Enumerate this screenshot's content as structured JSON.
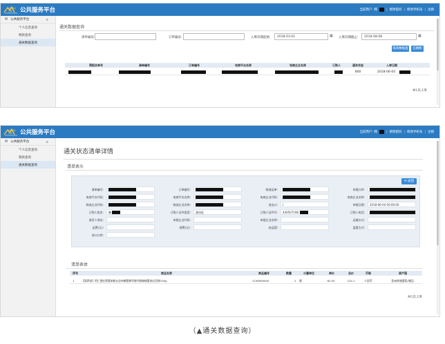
{
  "app": {
    "title": "公共服务平台",
    "logo_text": "中国电子口岸",
    "current_user_label": "当前用户: 韩",
    "links": [
      "修改密码",
      "修改手机号",
      "注销"
    ],
    "accent": "#2b7bc2"
  },
  "sidebar": {
    "header": "公共服务平台",
    "items": [
      "个人信息查询",
      "税款查询",
      "通关数据查询"
    ],
    "active_index": 2
  },
  "query": {
    "heading": "通关数据查询",
    "fields": [
      {
        "label": "清单编号:",
        "value": ""
      },
      {
        "label": "订单编号:",
        "value": ""
      },
      {
        "label": "入库日期起始:",
        "value": "2018-03-01"
      },
      {
        "label": "入库日期截止:",
        "value": "2018-08-08"
      }
    ],
    "buttons": [
      "电商数据查询",
      "已缴税"
    ],
    "table": {
      "columns": [
        "预报关单号",
        "清单编号",
        "订单编号",
        "电商平台名称",
        "电商企业名称",
        "订购人",
        "通关状态",
        "入库日期"
      ],
      "rows": [
        {
          "status": "800",
          "date": "2018-06-04"
        }
      ]
    },
    "pager": "共1页,1项"
  },
  "detail": {
    "heading": "通关状态清单详情",
    "header_section": "清单表头",
    "back_label": "返回",
    "rows": [
      [
        {
          "label": "清单编号:",
          "value": "",
          "redacted": true
        },
        {
          "label": "订单编号:",
          "value": "",
          "redacted": true
        },
        {
          "label": "物流运单:",
          "value": "",
          "redacted": true
        },
        {
          "label": "申报口岸:",
          "value": "",
          "redacted": true
        }
      ],
      [
        {
          "label": "电商平台代码:",
          "value": "",
          "redacted": true
        },
        {
          "label": "电商平台名称:",
          "value": "",
          "redacted": true
        },
        {
          "label": "电商企业代码:",
          "value": "",
          "redacted": true
        },
        {
          "label": "电商企业名称:",
          "value": "",
          "redacted": true
        }
      ],
      [
        {
          "label": "物流企业代码:",
          "value": "",
          "redacted": true
        },
        {
          "label": "物流企业名称:",
          "value": "",
          "redacted": true
        },
        {
          "label": "进出口:",
          "value": "I"
        },
        {
          "label": "申报日期:",
          "value": "2018-06-04 00:00:00"
        }
      ],
      [
        {
          "label": "订购人姓名:",
          "value": "韩",
          "redacted": true
        },
        {
          "label": "订购人证件类型:",
          "value": "身份证"
        },
        {
          "label": "订购人证件号:",
          "value": "440507198",
          "redacted": true
        },
        {
          "label": "订购人电话:",
          "value": "",
          "redacted": true
        }
      ],
      [
        {
          "label": "收货人地址:",
          "value": ""
        },
        {
          "label": "申报企业代码:",
          "value": ""
        },
        {
          "label": "申报企业名称:",
          "value": ""
        },
        {
          "label": "运输方式:",
          "value": ""
        }
      ],
      [
        {
          "label": "运费(元):",
          "value": ""
        },
        {
          "label": "保费(元):",
          "value": ""
        },
        {
          "label": "启运国:",
          "value": ""
        },
        {
          "label": "监管方式:",
          "value": ""
        }
      ],
      [
        {
          "label": "进口口岸:",
          "value": ""
        }
      ]
    ],
    "body_section": "清单表体",
    "items_table": {
      "columns": [
        "序号",
        "商品名称",
        "商品编号",
        "数量",
        "计量单位",
        "单价",
        "总价",
        "币制",
        "原产国"
      ],
      "rows": [
        {
          "no": "1",
          "name": "【双四包】阿仁堂红枣薏米粉五谷杂粮营养早餐代餐粉粉薏米红豆粉150g",
          "code": "2106909090",
          "qty": "2",
          "unit": "袋",
          "price": "62.05",
          "total": "124.1",
          "currency": "人民币",
          "origin": "亚洲其他国家(地区)"
        }
      ]
    },
    "pager": "共1页,1项"
  },
  "caption": "（▲通关数据查询）"
}
